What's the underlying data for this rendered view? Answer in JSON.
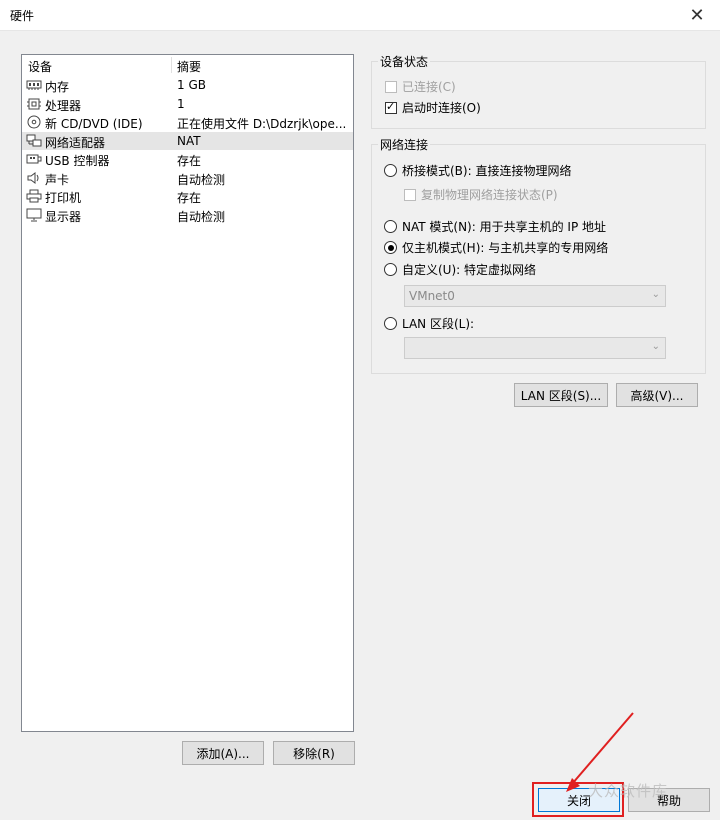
{
  "window": {
    "title": "硬件",
    "close_glyph": "✕"
  },
  "devices": {
    "headers": {
      "device": "设备",
      "summary": "摘要"
    },
    "rows": [
      {
        "name": "内存",
        "summary": "1 GB",
        "icon": "memory-icon"
      },
      {
        "name": "处理器",
        "summary": "1",
        "icon": "cpu-icon"
      },
      {
        "name": "新 CD/DVD (IDE)",
        "summary": "正在使用文件 D:\\Ddzrjk\\ope...",
        "icon": "cd-icon"
      },
      {
        "name": "网络适配器",
        "summary": "NAT",
        "icon": "network-icon",
        "selected": true
      },
      {
        "name": "USB 控制器",
        "summary": "存在",
        "icon": "usb-icon"
      },
      {
        "name": "声卡",
        "summary": "自动检测",
        "icon": "speaker-icon"
      },
      {
        "name": "打印机",
        "summary": "存在",
        "icon": "printer-icon"
      },
      {
        "name": "显示器",
        "summary": "自动检测",
        "icon": "monitor-icon"
      }
    ],
    "add_button": "添加(A)...",
    "remove_button": "移除(R)"
  },
  "device_status": {
    "legend": "设备状态",
    "connected": {
      "label": "已连接(C)",
      "checked": false,
      "enabled": false
    },
    "connect_at_power_on": {
      "label": "启动时连接(O)",
      "checked": true,
      "enabled": true
    }
  },
  "network_connection": {
    "legend": "网络连接",
    "bridged": "桥接模式(B): 直接连接物理网络",
    "replicate": "复制物理网络连接状态(P)",
    "nat": "NAT 模式(N): 用于共享主机的 IP 地址",
    "host_only": "仅主机模式(H): 与主机共享的专用网络",
    "custom": "自定义(U): 特定虚拟网络",
    "custom_value": "VMnet0",
    "lan_segment": "LAN 区段(L):",
    "lan_value": "",
    "selected": "host_only"
  },
  "buttons": {
    "lan_segments": "LAN 区段(S)...",
    "advanced": "高级(V)...",
    "close": "关闭",
    "help": "帮助"
  },
  "watermark": "大众软件库",
  "colors": {
    "selection": "#e5e5e5",
    "focus_border": "#0078d7",
    "annotation_red": "#e02020"
  }
}
